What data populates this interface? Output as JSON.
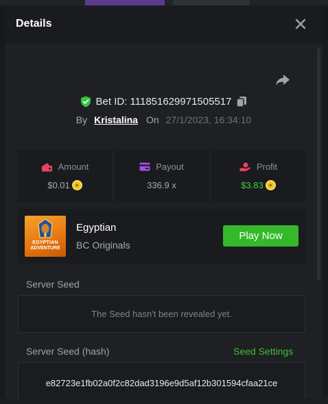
{
  "modal": {
    "title": "Details"
  },
  "bet": {
    "id_text": "Bet ID: 111851629971505517",
    "by_label": "By",
    "user": "Kristalina",
    "on_label": "On",
    "date": "27/1/2023, 16:34:10"
  },
  "stats": [
    {
      "label": "Amount",
      "value": "$0.01",
      "icon": "wallet-money-icon",
      "coin": true
    },
    {
      "label": "Payout",
      "value": "336.9 x",
      "icon": "card-icon",
      "coin": false
    },
    {
      "label": "Profit",
      "value": "$3.83",
      "icon": "profit-hand-icon",
      "coin": true
    }
  ],
  "game": {
    "name": "Egyptian",
    "provider": "BC Originals",
    "thumb_line1": "EGYPTIAN",
    "thumb_line2": "ADVENTURE",
    "play_label": "Play Now"
  },
  "server_seed": {
    "label": "Server Seed",
    "value": "The Seed hasn't been revealed yet."
  },
  "server_seed_hash": {
    "label": "Server Seed (hash)",
    "settings_label": "Seed Settings",
    "value": "e82723e1fb02a0f2c82dad3196e9d5af12b301594cfaa21ce"
  },
  "colors": {
    "accent_green": "#35b92b",
    "profit_green": "#3dd23b",
    "amount_pink": "#e9415f",
    "payout_purple": "#a34de2",
    "shield_green": "#2fc73c",
    "coin_yellow": "#f3c41a"
  }
}
